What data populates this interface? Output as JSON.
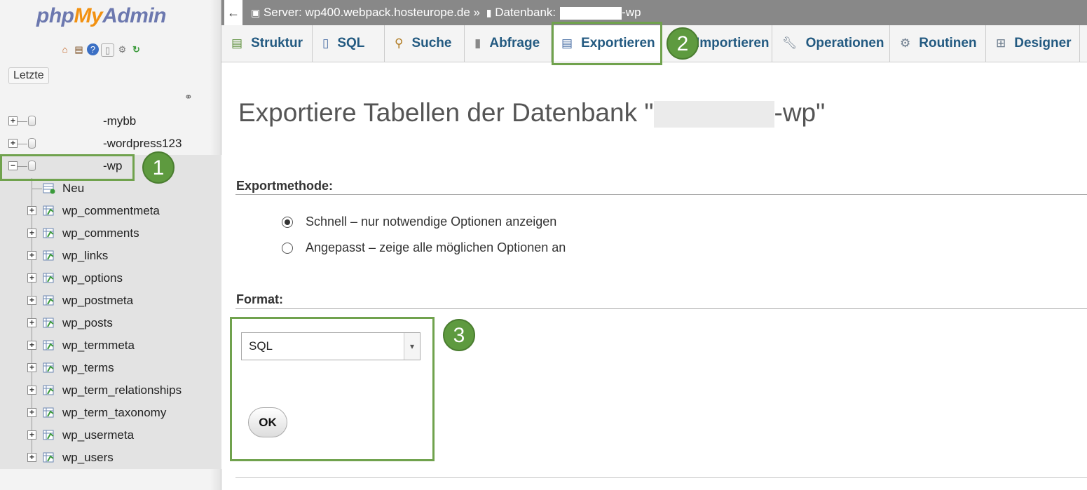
{
  "sidebar": {
    "logo": {
      "php": "php",
      "my": "My",
      "admin": "Admin"
    },
    "recent_label": "Letzte",
    "databases": [
      {
        "label": "-mybb",
        "toggle": "+"
      },
      {
        "label": "-wordpress123",
        "toggle": "+"
      },
      {
        "label": "-wp",
        "toggle": "−"
      }
    ],
    "new_label": "Neu",
    "tables": [
      "wp_commentmeta",
      "wp_comments",
      "wp_links",
      "wp_options",
      "wp_postmeta",
      "wp_posts",
      "wp_termmeta",
      "wp_terms",
      "wp_term_relationships",
      "wp_term_taxonomy",
      "wp_usermeta",
      "wp_users"
    ]
  },
  "topbar": {
    "back": "←",
    "server_label": "Server: wp400.webpack.hosteurope.de »",
    "db_label": "Datenbank:",
    "db_suffix": "-wp"
  },
  "tabs": [
    {
      "label": "Struktur",
      "icon": "structure-icon"
    },
    {
      "label": "SQL",
      "icon": "sql-icon"
    },
    {
      "label": "Suche",
      "icon": "search-icon"
    },
    {
      "label": "Abfrage",
      "icon": "query-icon"
    },
    {
      "label": "Exportieren",
      "icon": "export-icon"
    },
    {
      "label": "Importieren",
      "icon": "import-icon"
    },
    {
      "label": "Operationen",
      "icon": "wrench-icon"
    },
    {
      "label": "Routinen",
      "icon": "routines-icon"
    },
    {
      "label": "Designer",
      "icon": "designer-icon"
    }
  ],
  "main": {
    "title_prefix": "Exportiere Tabellen der Datenbank \"",
    "title_suffix": "-wp\"",
    "export_method_heading": "Exportmethode:",
    "method_quick": "Schnell – nur notwendige Optionen anzeigen",
    "method_custom": "Angepasst – zeige alle möglichen Optionen an",
    "format_heading": "Format:",
    "format_value": "SQL",
    "ok_label": "OK"
  },
  "annotations": {
    "step1": "1",
    "step2": "2",
    "step3": "3",
    "color": "#70a24d"
  }
}
